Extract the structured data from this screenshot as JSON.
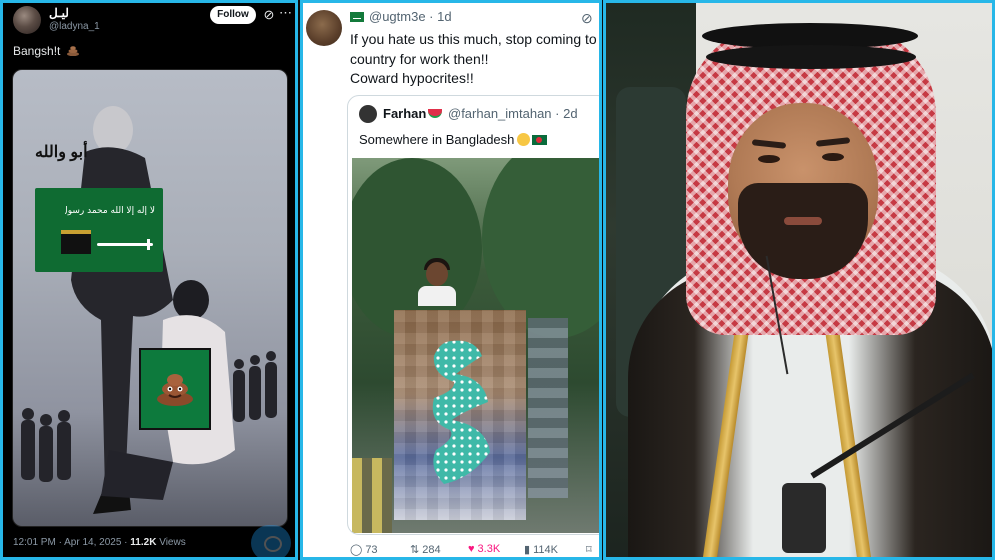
{
  "panel1": {
    "display_name": "ليـل",
    "handle": "@ladyna_1",
    "follow_label": "Follow",
    "tweet_text": "Bangsh!t",
    "image_arabic_text": "أبو والله",
    "flag_script": "لا إله إلا الله محمد رسول الله",
    "timestamp": "12:01 PM · Apr 14, 2025 · ",
    "views_count": "11.2K",
    "views_label": " Views"
  },
  "panel2": {
    "author_handle": "@ugtm3e · 1d",
    "text_line1": "If you hate us this much, stop coming to o",
    "text_line2": "country for work then!!",
    "text_line3": "Coward hypocrites!!",
    "quoted": {
      "name": "Farhan",
      "handle": "@farhan_imtahan · 2d",
      "text": "Somewhere in Bangladesh"
    },
    "actions": {
      "replies": "73",
      "reposts": "284",
      "likes": "3.3K",
      "views": "114K"
    }
  },
  "icons": [
    "grok-icon",
    "more-icon",
    "poop-emoji-icon",
    "reply-icon",
    "repost-icon",
    "heart-icon",
    "views-icon",
    "bookmark-icon",
    "watermelon-emoji-icon",
    "smile-emoji-icon",
    "bangladesh-flag-icon",
    "saudi-flag-icon",
    "chat-fab-icon"
  ],
  "colors": {
    "border_accent": "#27b7e8",
    "x_text_secondary": "#536471",
    "like_pink": "#f91880",
    "saudi_green": "#0f6b32"
  }
}
